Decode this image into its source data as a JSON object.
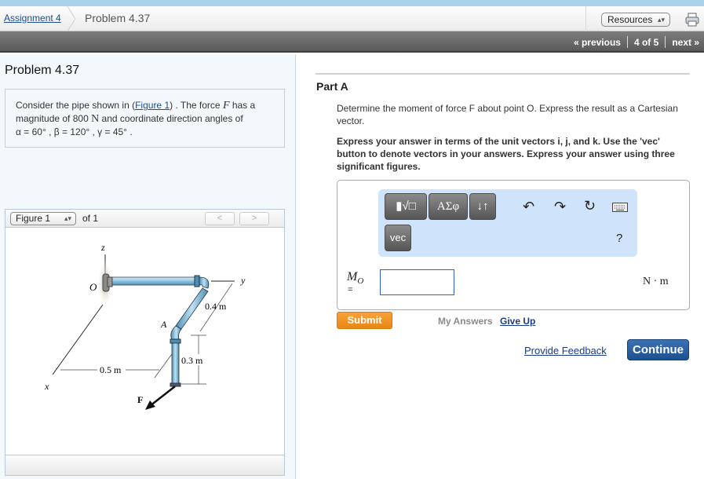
{
  "header": {
    "breadcrumb_assignment": "Assignment 4",
    "breadcrumb_problem": "Problem 4.37",
    "resources_select": "Resources",
    "print_icon": "printer-icon"
  },
  "nav": {
    "previous": "« previous",
    "position": "4 of 5",
    "next": "next »"
  },
  "problem": {
    "title": "Problem 4.37",
    "text_part1": "Consider the pipe shown in (",
    "figure_link": "Figure 1",
    "text_part2": ") . The force ",
    "force_symbol": "F",
    "text_part3": " has a magnitude of 800 ",
    "unit_N": "N",
    "text_part4": " and coordinate direction angles of",
    "angles": "α = 60° , β = 120° , γ = 45° ."
  },
  "figure": {
    "select_value": "Figure 1",
    "of_label": "of 1",
    "prev_button": "<",
    "next_button": ">",
    "labels": {
      "z": "z",
      "y": "y",
      "x": "x",
      "O": "O",
      "A": "A",
      "F": "F",
      "dim_04": "0.4 m",
      "dim_05": "0.5 m",
      "dim_03": "0.3 m"
    }
  },
  "partA": {
    "title": "Part A",
    "question": "Determine the moment of force F about point O. Express the result as a Cartesian vector.",
    "instructions": "Express your answer in terms of the unit vectors i, j, and k. Use the 'vec' button to denote vectors in your answers. Express your answer using three significant figures.",
    "toolbar": {
      "templates_button": "▮√□",
      "symbols_button": "ΑΣφ",
      "arrows_button": "↓↑",
      "vec_button": "vec",
      "help": "?"
    },
    "answer_label": "M",
    "answer_sub": "O",
    "answer_eq": "=",
    "answer_value": "",
    "unit": "N · m",
    "submit": "Submit",
    "my_answers": "My Answers",
    "give_up": "Give Up",
    "provide_feedback": "Provide Feedback",
    "continue": "Continue"
  }
}
